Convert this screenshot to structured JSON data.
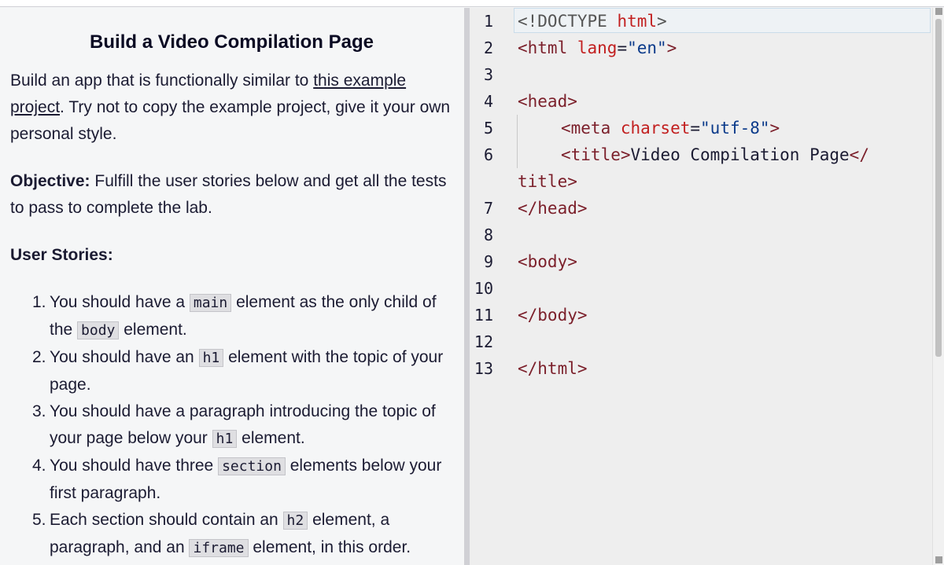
{
  "instructions": {
    "title": "Build a Video Compilation Page",
    "intro_before": "Build an app that is functionally similar to ",
    "intro_link": "this example project",
    "intro_after": ". Try not to copy the example project, give it your own personal style.",
    "objective_label": "Objective:",
    "objective_text": " Fulfill the user stories below and get all the tests to pass to complete the lab.",
    "stories_label": "User Stories:",
    "stories": [
      {
        "num": "1.",
        "a": "You should have a ",
        "c1": "main",
        "b": " element as the only child of the ",
        "c2": "body",
        "d": " element."
      },
      {
        "num": "2.",
        "a": "You should have an ",
        "c1": "h1",
        "b": " element with the topic of your page."
      },
      {
        "num": "3.",
        "a": "You should have a paragraph introducing the topic of your page below your ",
        "c1": "h1",
        "b": " element."
      },
      {
        "num": "4.",
        "a": "You should have three ",
        "c1": "section",
        "b": " elements below your first paragraph."
      },
      {
        "num": "5.",
        "a": "Each section should contain an ",
        "c1": "h2",
        "b": " element, a paragraph, and an ",
        "c2": "iframe",
        "d": " element, in this order."
      }
    ]
  },
  "editor": {
    "line_numbers": [
      "1",
      "2",
      "3",
      "4",
      "5",
      "6",
      "7",
      "8",
      "9",
      "10",
      "11",
      "12",
      "13"
    ],
    "code": {
      "l1_open": "<!DOCTYPE ",
      "l1_kw": "html",
      "l1_close": ">",
      "l2_open": "<html ",
      "l2_attr": "lang",
      "l2_eq": "=",
      "l2_val": "\"en\"",
      "l2_close": ">",
      "l4": "<head>",
      "l5_open": "<meta ",
      "l5_attr": "charset",
      "l5_eq": "=",
      "l5_val": "\"utf-8\"",
      "l5_close": ">",
      "l6_open": "<title>",
      "l6_text": "Video Compilation Page",
      "l6_close": "</",
      "l6_wrap": "title>",
      "l7": "</head>",
      "l9": "<body>",
      "l11": "</body>",
      "l13": "</html>"
    }
  }
}
